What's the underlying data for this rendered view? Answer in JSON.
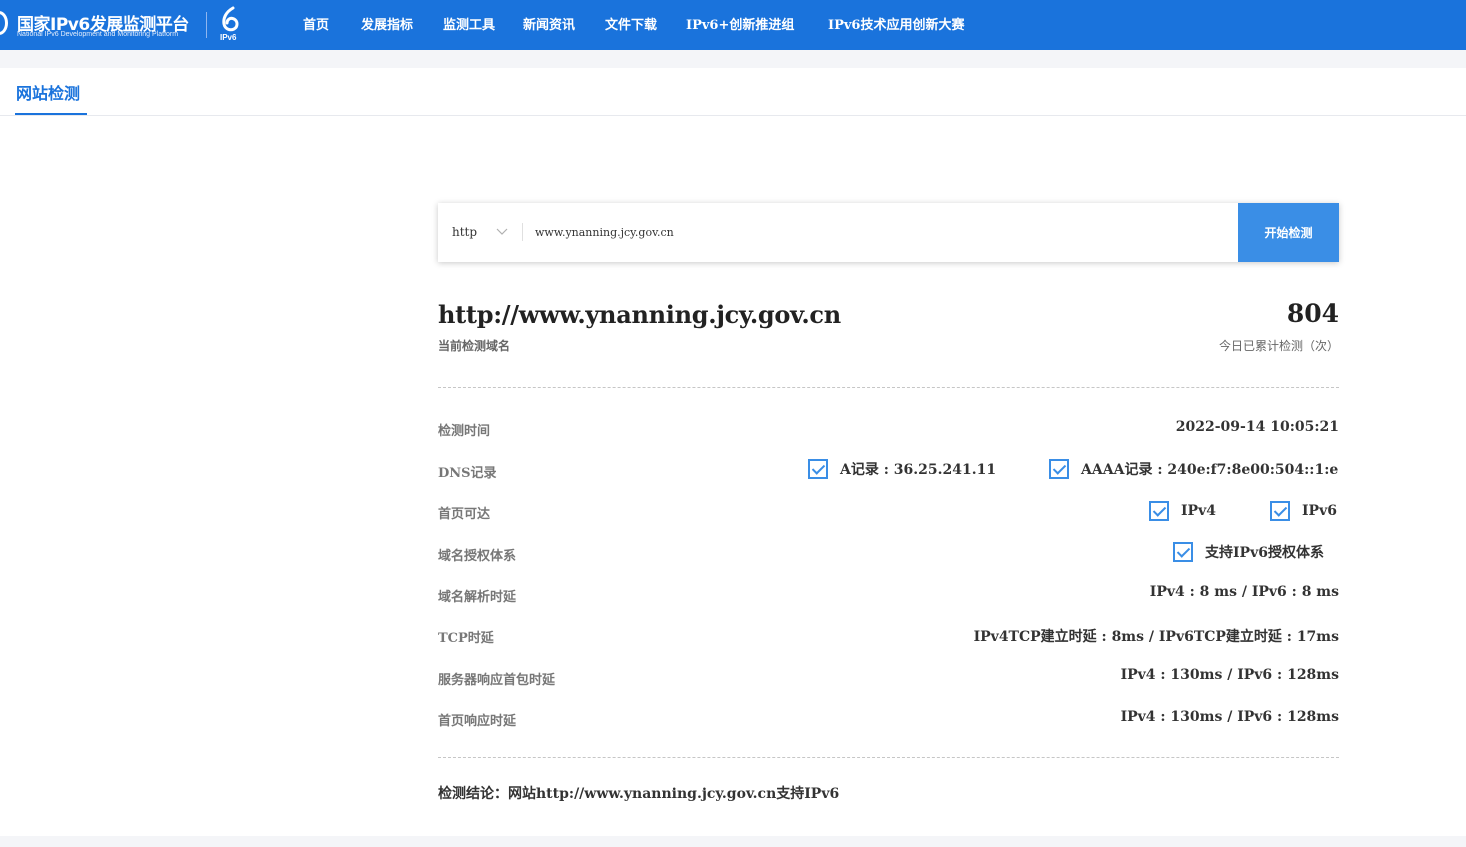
{
  "header": {
    "logo_cn": "国家IPv6发展监测平台",
    "logo_en": "National IPv6 Development and Monitoring Platform",
    "logo_badge": "IPv6",
    "nav": [
      "首页",
      "发展指标",
      "监测工具",
      "新闻资讯",
      "文件下载",
      "IPv6+创新推进组",
      "IPv6技术应用创新大赛"
    ]
  },
  "tab": {
    "label": "网站检测"
  },
  "search": {
    "protocol": "http",
    "url": "www.ynanning.jcy.gov.cn",
    "button": "开始检测"
  },
  "summary": {
    "domain": "http://www.ynanning.jcy.gov.cn",
    "domain_caption": "当前检测域名",
    "count": "804",
    "count_caption": "今日已累计检测（次）"
  },
  "rows": {
    "time": {
      "label": "检测时间",
      "value": "2022-09-14 10:05:21"
    },
    "dns": {
      "label": "DNS记录",
      "a": "A记录 : 36.25.241.11",
      "aaaa": "AAAA记录 : 240e:f7:8e00:504::1:e"
    },
    "reach": {
      "label": "首页可达",
      "ipv4": "IPv4",
      "ipv6": "IPv6"
    },
    "auth": {
      "label": "域名授权体系",
      "value": "支持IPv6授权体系"
    },
    "resolve": {
      "label": "域名解析时延",
      "value": "IPv4 : 8 ms / IPv6 : 8 ms"
    },
    "tcp": {
      "label": "TCP时延",
      "value": "IPv4TCP建立时延 : 8ms / IPv6TCP建立时延 : 17ms"
    },
    "server": {
      "label": "服务器响应首包时延",
      "value": "IPv4 : 130ms / IPv6 : 128ms"
    },
    "home": {
      "label": "首页响应时延",
      "value": "IPv4 : 130ms / IPv6 : 128ms"
    }
  },
  "conclusion": "检测结论：网站http://www.ynanning.jcy.gov.cn支持IPv6",
  "colors": {
    "brand": "#1a73dc",
    "button": "#3a8ee6",
    "check": "#3a8ee6"
  }
}
